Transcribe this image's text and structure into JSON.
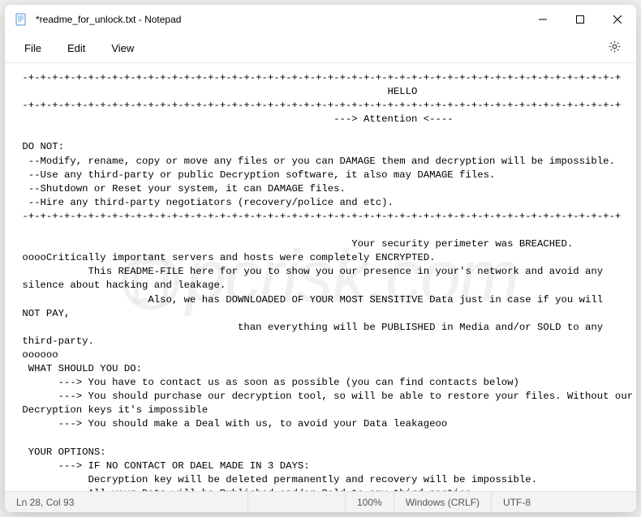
{
  "window": {
    "title": "*readme_for_unlock.txt - Notepad"
  },
  "menu": {
    "file": "File",
    "edit": "Edit",
    "view": "View"
  },
  "document": {
    "text": " -+-+-+-+-+-+-+-+-+-+-+-+-+-+-+-+-+-+-+-+-+-+-+-+-+-+-+-+-+-+-+-+-+-+-+-+-+-+-+-+-+-+-+-+-+-+-+-+-+-+\n                                                              HELLO\n -+-+-+-+-+-+-+-+-+-+-+-+-+-+-+-+-+-+-+-+-+-+-+-+-+-+-+-+-+-+-+-+-+-+-+-+-+-+-+-+-+-+-+-+-+-+-+-+-+-+\n                                                     ---> Attention <----\n\n DO NOT:\n  --Modify, rename, copy or move any files or you can DAMAGE them and decryption will be impossible.\n  --Use any third-party or public Decryption software, it also may DAMAGE files.\n  --Shutdown or Reset your system, it can DAMAGE files.\n  --Hire any third-party negotiators (recovery/police and etc).\n -+-+-+-+-+-+-+-+-+-+-+-+-+-+-+-+-+-+-+-+-+-+-+-+-+-+-+-+-+-+-+-+-+-+-+-+-+-+-+-+-+-+-+-+-+-+-+-+-+-+\n\n                                                        Your security perimeter was BREACHED.\n ooooCritically important servers and hosts were completely ENCRYPTED.\n            This README-FILE here for you to show you our presence in your's network and avoid any\n silence about hacking and leakage.\n                      Also, we has DOWNLOADED OF YOUR MOST SENSITIVE Data just in case if you will\n NOT PAY,\n                                     than everything will be PUBLISHED in Media and/or SOLD to any\n third-party.\n oooooo\n  WHAT SHOULD YOU DO:\n       ---> You have to contact us as soon as possible (you can find contacts below)\n       ---> You should purchase our decryption tool, so will be able to restore your files. Without our\n Decryption keys it's impossible\n       ---> You should make a Deal with us, to avoid your Data leakageoo\n\n  YOUR OPTIONS:\n       ---> IF NO CONTACT OR DAEL MADE IN 3 DAYS:\n            Decryption key will be deleted permanently and recovery will be impossible.\n            All your Data will be Published and/or Sold to any third-parties\n            Information regarding vulnerabilities of your network also can be published and/or shared"
  },
  "status": {
    "position": "Ln 28, Col 93",
    "zoom": "100%",
    "line_ending": "Windows (CRLF)",
    "encoding": "UTF-8"
  },
  "watermark": "pcrisk.com"
}
